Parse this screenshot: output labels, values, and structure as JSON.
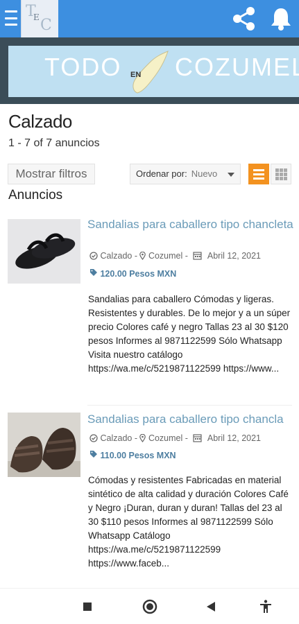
{
  "app": {
    "logo_letters": [
      "T",
      "E",
      "C"
    ],
    "banner_words": [
      "TODO",
      "EN",
      "COZUMEL"
    ]
  },
  "icons": {
    "menu": "hamburger-menu-icon",
    "share": "share-icon",
    "notifications": "bell-icon",
    "category": "check-circle-icon",
    "location": "map-pin-icon",
    "date": "calendar-icon",
    "price": "tag-icon"
  },
  "colors": {
    "topbar": "#3d8fe0",
    "accent": "#f39220",
    "link": "#6a9bb8",
    "price": "#4d7ea0"
  },
  "page": {
    "title": "Calzado",
    "count": "1 - 7 of 7 anuncios"
  },
  "toolbar": {
    "filters_label": "Mostrar filtros",
    "sort_label": "Ordenar por:",
    "sort_value": "Nuevo",
    "view_active": "list"
  },
  "section_title": "Anuncios",
  "listings": [
    {
      "title": "Sandalias para caballero tipo chancleta",
      "category": "Calzado",
      "location": "Cozumel",
      "date": "Abril 12, 2021",
      "price": "120.00 Pesos MXN",
      "description": "Sandalias para caballero Cómodas y ligeras. Resistentes y durables. De lo mejor y a un súper precio Colores café y negro Tallas 23 al 30 $120 pesos Informes al 9871122599 Sólo Whatsapp Visita nuestro catálogo https://wa.me/c/5219871122599 https://www..."
    },
    {
      "title": "Sandalias para caballero tipo chancla",
      "category": "Calzado",
      "location": "Cozumel",
      "date": "Abril 12, 2021",
      "price": "110.00 Pesos MXN",
      "description": "Cómodas y resistentes Fabricadas en material sintético de alta calidad y duración Colores Café y Negro ¡Duran, duran y duran! Tallas del 23 al 30 $110 pesos Informes al 9871122599 Sólo Whatsapp Catálogo https://wa.me/c/5219871122599 https://www.faceb..."
    }
  ],
  "system_nav": [
    "recents-square-icon",
    "home-circle-icon",
    "back-triangle-icon",
    "accessibility-icon"
  ]
}
